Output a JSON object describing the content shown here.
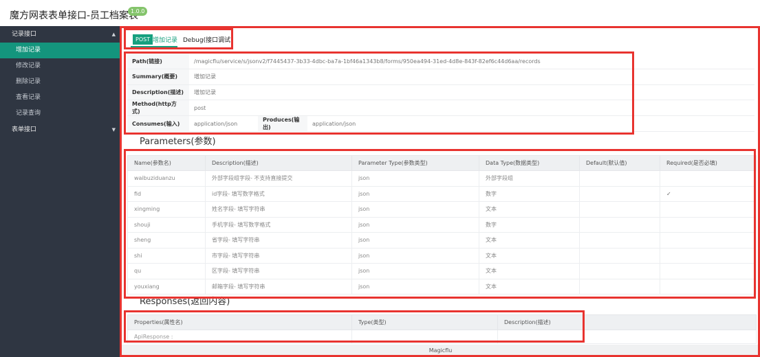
{
  "header": {
    "title": "魔方网表表单接口-员工档案表",
    "version": "1.0.0"
  },
  "sidebar": {
    "groups": [
      {
        "label": "记录接口",
        "caret": "▲",
        "items": [
          {
            "label": "增加记录"
          },
          {
            "label": "修改记录"
          },
          {
            "label": "删除记录"
          },
          {
            "label": "查看记录"
          },
          {
            "label": "记录查询"
          }
        ]
      },
      {
        "label": "表单接口",
        "caret": "▼"
      }
    ]
  },
  "tabs": {
    "method_badge": "POST",
    "active": "增加记录",
    "debug": "Debug(接口调试)"
  },
  "info": {
    "path_label": "Path(链接)",
    "path_value": "/magicflu/service/s/jsonv2/f7445437-3b33-4dbc-ba7a-1bf46a1343b8/forms/950ea494-31ed-4d8e-843f-82ef6c44d6aa/records",
    "summary_label": "Summary(概要)",
    "summary_value": "增加记录",
    "description_label": "Description(描述)",
    "description_value": "增加记录",
    "method_label": "Method(http方式)",
    "method_value": "post",
    "consumes_label": "Consumes(输入)",
    "consumes_value": "application/json",
    "produces_label": "Produces(输出)",
    "produces_value": "application/json"
  },
  "parameters": {
    "title": "Parameters(参数)",
    "headers": [
      "Name(参数名)",
      "Description(描述)",
      "Parameter Type(参数类型)",
      "Data Type(数据类型)",
      "Default(默认值)",
      "Required(是否必填)"
    ],
    "rows": [
      [
        "waibuziduanzu",
        "外部字段组字段- 不支持直接提交",
        "json",
        "外部字段组",
        "",
        ""
      ],
      [
        "fid",
        "id字段- 填写数字格式",
        "json",
        "数字",
        "",
        "✓"
      ],
      [
        "xingming",
        "姓名字段- 填写字符串",
        "json",
        "文本",
        "",
        ""
      ],
      [
        "shouji",
        "手机字段- 填写数字格式",
        "json",
        "数字",
        "",
        ""
      ],
      [
        "sheng",
        "省字段- 填写字符串",
        "json",
        "文本",
        "",
        ""
      ],
      [
        "shi",
        "市字段- 填写字符串",
        "json",
        "文本",
        "",
        ""
      ],
      [
        "qu",
        "区字段- 填写字符串",
        "json",
        "文本",
        "",
        ""
      ],
      [
        "youxiang",
        "邮箱字段- 填写字符串",
        "json",
        "文本",
        "",
        ""
      ]
    ]
  },
  "responses": {
    "title": "Responses(返回内容)",
    "headers": [
      "Properties(属性名)",
      "Type(类型)",
      "Description(描述)"
    ],
    "row": [
      "ApiResponse :",
      "",
      ""
    ]
  },
  "footer": {
    "text": "Magicflu"
  },
  "colors": {
    "accent": "#16a07f",
    "sidebar_bg": "#2f3642",
    "highlight": "#e8332f"
  }
}
